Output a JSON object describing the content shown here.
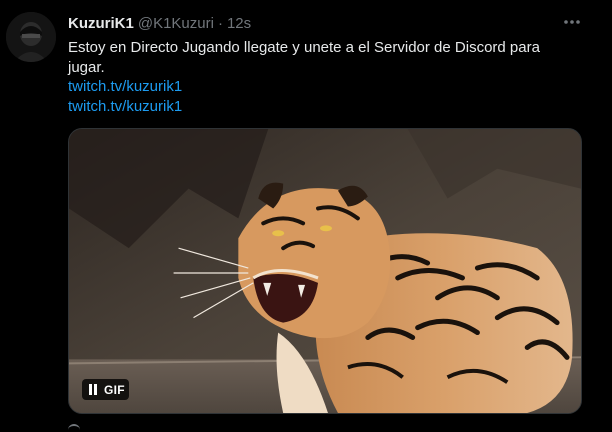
{
  "tweet": {
    "display_name": "KuzuriK1",
    "handle": "@K1Kuzuri",
    "separator": "·",
    "time": "12s",
    "text": "Estoy en Directo Jugando llegate y unete a el Servidor de Discord para jugar.",
    "links": [
      {
        "text": "twitch.tv/kuzurik1"
      },
      {
        "text": "twitch.tv/kuzurik1"
      }
    ],
    "media": {
      "badge": "GIF",
      "subject": "roaring tiger"
    }
  },
  "icons": {
    "more": "more-dots-icon",
    "pause": "pause-icon"
  },
  "colors": {
    "background": "#000000",
    "text": "#e7e9ea",
    "muted": "#71767b",
    "link": "#1d9bf0"
  }
}
